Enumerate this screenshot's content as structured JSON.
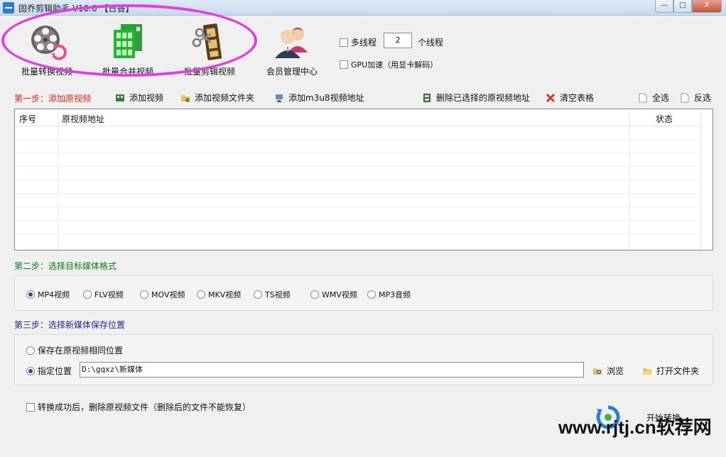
{
  "window": {
    "title": "固乔剪辑助手 V10.0 【日香】",
    "minimize": "—",
    "maximize": "□",
    "close": "X"
  },
  "toolbar": {
    "batch_convert": "批量转换视频",
    "batch_merge": "批量合并视频",
    "batch_clip": "批量剪辑视频",
    "member_center": "会员管理中心"
  },
  "options": {
    "multithread_label": "多线程",
    "thread_count": "2",
    "thread_suffix": "个线程",
    "gpu_label": "GPU加速（用显卡解码）"
  },
  "step1": {
    "heading": "第一步：添加原视频",
    "add_video": "添加视频",
    "add_folder": "添加视频文件夹",
    "add_m3u8": "添加m3u8视频地址",
    "delete_selected": "删除已选择的原视频地址",
    "clear_table": "清空表格",
    "select_all": "全选",
    "invert_select": "反选"
  },
  "table": {
    "columns": [
      "序号",
      "原视频地址",
      "状态"
    ]
  },
  "step2": {
    "heading": "第二步：选择目标媒体格式",
    "formats": [
      "MP4视频",
      "FLV视频",
      "MOV视频",
      "MKV视频",
      "TS视频",
      "WMV视频",
      "MP3音频"
    ],
    "selected": "MP4视频"
  },
  "step3": {
    "heading": "第三步：选择新媒体保存位置",
    "same_location": "保存在原视频相同位置",
    "specify_location": "指定位置",
    "path": "D:\\gqxz\\新媒体",
    "browse": "浏览",
    "open_folder": "打开文件夹"
  },
  "footer": {
    "delete_after": "转换成功后，删除原视频文件（删除后的文件不能恢复）",
    "start": "开始转换"
  },
  "watermark": "www.rjtj.cn软荐网",
  "colors": {
    "step1": "#d12b1c",
    "step2": "#0e7a16",
    "step3": "#1b2a88",
    "highlight": "#e040e0"
  }
}
